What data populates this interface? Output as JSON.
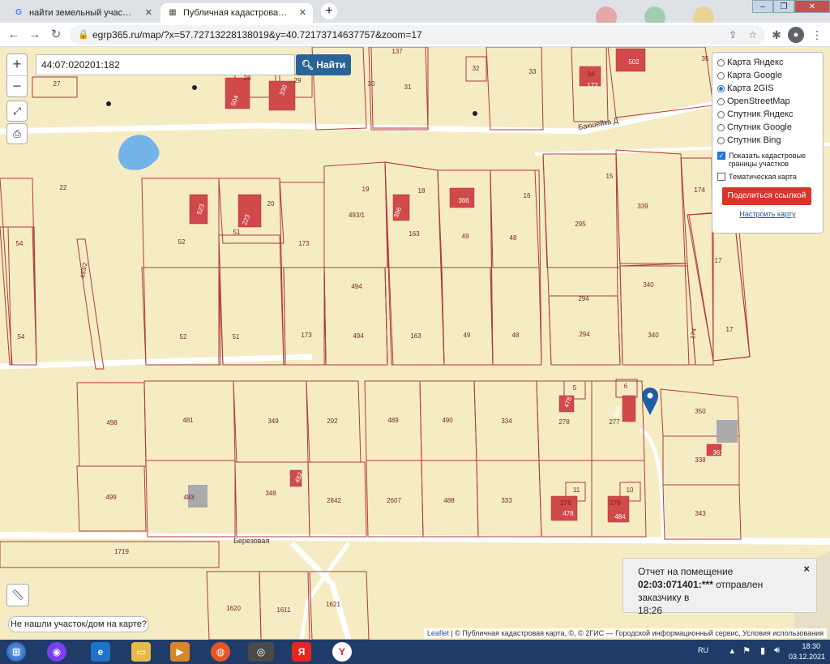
{
  "browser": {
    "tabs": [
      {
        "label": "найти земельный участок по ка",
        "favicon": "G",
        "favicon_color": "#4285f4",
        "active": false
      },
      {
        "label": "Публичная кадастровая карта К",
        "favicon": "▦",
        "favicon_color": "#555555",
        "active": true
      }
    ],
    "new_tab": "+",
    "url": "egrp365.ru/map/?x=57.72713228138019&y=40.72173714637757&zoom=17"
  },
  "search": {
    "value": "44:07:020201:182",
    "button": "Найти"
  },
  "zoom": {
    "in": "+",
    "out": "−"
  },
  "layers": {
    "options": [
      {
        "label": "Карта Яндекс",
        "selected": false
      },
      {
        "label": "Карта Google",
        "selected": false
      },
      {
        "label": "Карта 2GIS",
        "selected": true
      },
      {
        "label": "OpenStreetMap",
        "selected": false
      },
      {
        "label": "Спутник Яндекс",
        "selected": false
      },
      {
        "label": "Спутник Google",
        "selected": false
      },
      {
        "label": "Спутник Bing",
        "selected": false
      }
    ],
    "checkboxes": [
      {
        "label": "Показать кадастровые границы участков",
        "checked": true
      },
      {
        "label": "Тематическая карта",
        "checked": false
      }
    ],
    "share_button": "Поделиться ссылкой",
    "configure_link": "Настроить карту"
  },
  "streets": {
    "top": "Бакшейка Д",
    "bottom": "Березовая"
  },
  "parcels": [
    "137",
    "27",
    "28",
    "29",
    "30",
    "31",
    "32",
    "33",
    "34",
    "35",
    "22",
    "20",
    "19",
    "18",
    "16",
    "15",
    "52",
    "51",
    "173",
    "493/1",
    "163",
    "49",
    "48",
    "295",
    "339",
    "174",
    "54",
    "493/2",
    "494",
    "294",
    "340",
    "17",
    "493/2",
    "52",
    "51",
    "173",
    "494",
    "163",
    "49",
    "48",
    "294",
    "340",
    "174",
    "17",
    "54",
    "5",
    "6",
    "498",
    "481",
    "349",
    "292",
    "489",
    "490",
    "334",
    "278",
    "277",
    "350",
    "499",
    "483",
    "348",
    "2842",
    "2607",
    "488",
    "333",
    "276",
    "279",
    "338",
    "343",
    "11",
    "10",
    "1719",
    "1620",
    "1611",
    "1621"
  ],
  "houses": [
    "504",
    "330",
    "172",
    "502",
    "523",
    "223",
    "396",
    "366",
    "478",
    "480",
    "482",
    "361",
    "478",
    "484"
  ],
  "not_found": "Не нашли участок/дом на карте?",
  "toast": {
    "line1": "Отчет на помещение",
    "code": "02:03:071401:***",
    "line2": " отправлен заказчику в",
    "time": "18:26",
    "close": "×"
  },
  "attribution": {
    "leaflet": "Leaflet",
    "rest": " | © Публичная кадастровая карта, ©, © 2ГИС — Городской информационный сервис, Условия использования"
  },
  "taskbar": {
    "lang": "RU",
    "time": "18:30",
    "date": "03.12.2021"
  },
  "colors": {
    "parcel_border": "#b33a3a",
    "house_fill": "#d04a4a",
    "map_bg": "#f5ecc4",
    "accent": "#2a6496",
    "share": "#d9342b"
  }
}
